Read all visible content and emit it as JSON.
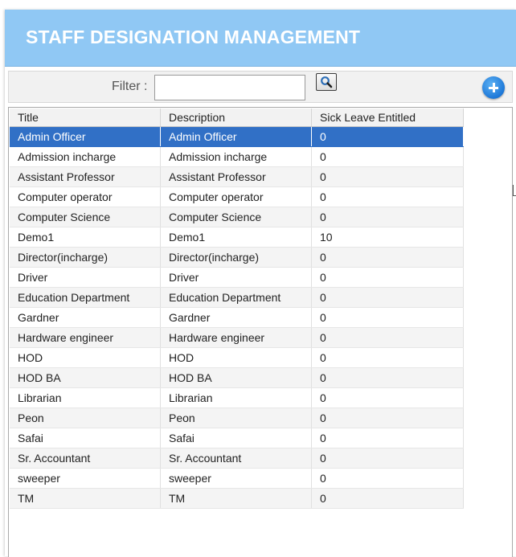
{
  "header": {
    "title": "STAFF DESIGNATION MANAGEMENT"
  },
  "toolbar": {
    "filter_label": "Filter :",
    "filter_value": "",
    "filter_placeholder": ""
  },
  "table": {
    "columns": [
      "Title",
      "Description",
      "Sick Leave Entitled"
    ],
    "rows": [
      [
        "Admin Officer",
        "Admin Officer",
        "0"
      ],
      [
        "Admission incharge",
        "Admission incharge",
        "0"
      ],
      [
        "Assistant Professor",
        "Assistant Professor",
        "0"
      ],
      [
        "Computer operator",
        "Computer operator",
        "0"
      ],
      [
        "Computer Science",
        "Computer Science",
        "0"
      ],
      [
        "Demo1",
        "Demo1",
        "10"
      ],
      [
        "Director(incharge)",
        "Director(incharge)",
        "0"
      ],
      [
        "Driver",
        "Driver",
        "0"
      ],
      [
        "Education Department",
        "Education Department",
        "0"
      ],
      [
        "Gardner",
        "Gardner",
        "0"
      ],
      [
        "Hardware engineer",
        "Hardware engineer",
        "0"
      ],
      [
        "HOD",
        "HOD",
        "0"
      ],
      [
        "HOD BA",
        "HOD BA",
        "0"
      ],
      [
        "Librarian",
        "Librarian",
        "0"
      ],
      [
        "Peon",
        "Peon",
        "0"
      ],
      [
        "Safai",
        "Safai",
        "0"
      ],
      [
        "Sr. Accountant",
        "Sr. Accountant",
        "0"
      ],
      [
        "sweeper",
        "sweeper",
        "0"
      ],
      [
        "TM",
        "TM",
        "0"
      ]
    ],
    "selected_index": 0
  },
  "icons": {
    "search": "search-icon",
    "add": "add-icon"
  },
  "colors": {
    "header_bg": "#90c8f4",
    "selection": "#3170c6",
    "add_button": "#1d78d8"
  }
}
